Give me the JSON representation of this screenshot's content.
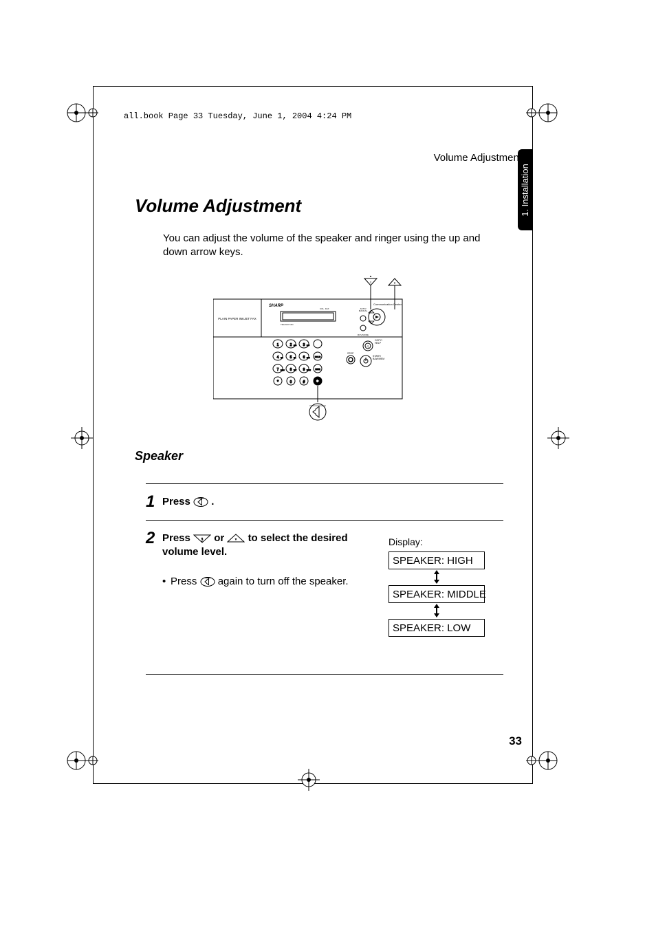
{
  "crop_info": "all.book  Page 33  Tuesday, June 1, 2004  4:24 PM",
  "running_head": "Volume Adjustment",
  "side_tab": "1. Installation",
  "title": "Volume Adjustment",
  "intro": "You can adjust the volume of the speaker and ringer using the up and down arrow keys.",
  "device_label": "PLAIN PAPER INKJET FAX",
  "device_brand": "SHARP",
  "device_header_right": "Communication Center",
  "subheading": "Speaker",
  "steps": {
    "s1": {
      "num": "1",
      "a": "Press ",
      "b": "."
    },
    "s2": {
      "num": "2",
      "a": "Press ",
      "b": " or ",
      "c": " to select the desired volume level.",
      "sub_a": "Press ",
      "sub_b": " again to turn off the speaker."
    }
  },
  "display_label": "Display:",
  "display_high": "SPEAKER: HIGH",
  "display_middle": "SPEAKER: MIDDLE",
  "display_low": "SPEAKER: LOW",
  "page_number": "33"
}
